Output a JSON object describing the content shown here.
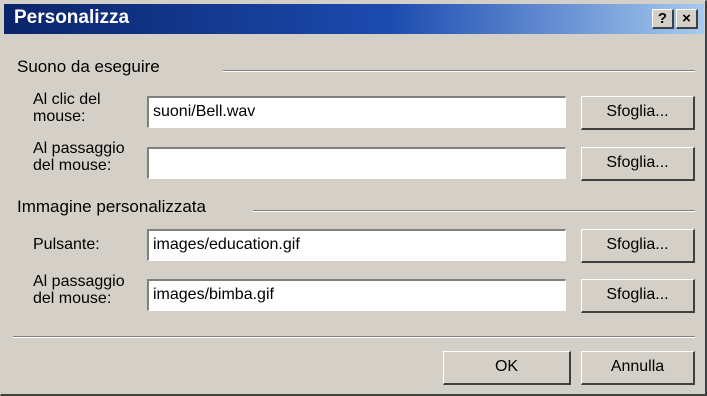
{
  "window": {
    "title": "Personalizza",
    "help_label": "?",
    "close_label": "×"
  },
  "sound_group": {
    "label": "Suono da eseguire",
    "click": {
      "label_line1": "Al clic del",
      "label_line2": "mouse:",
      "value": "suoni/Bell.wav",
      "browse_label": "Sfoglia..."
    },
    "hover": {
      "label_line1": "Al passaggio",
      "label_line2": "del mouse:",
      "value": "",
      "browse_label": "Sfoglia..."
    }
  },
  "image_group": {
    "label": "Immagine personalizzata",
    "button": {
      "label": "Pulsante:",
      "value": "images/education.gif",
      "browse_label": "Sfoglia..."
    },
    "hover": {
      "label_line1": "Al passaggio",
      "label_line2": "del mouse:",
      "value": "images/bimba.gif",
      "browse_label": "Sfoglia..."
    }
  },
  "footer": {
    "ok_label": "OK",
    "cancel_label": "Annulla"
  }
}
